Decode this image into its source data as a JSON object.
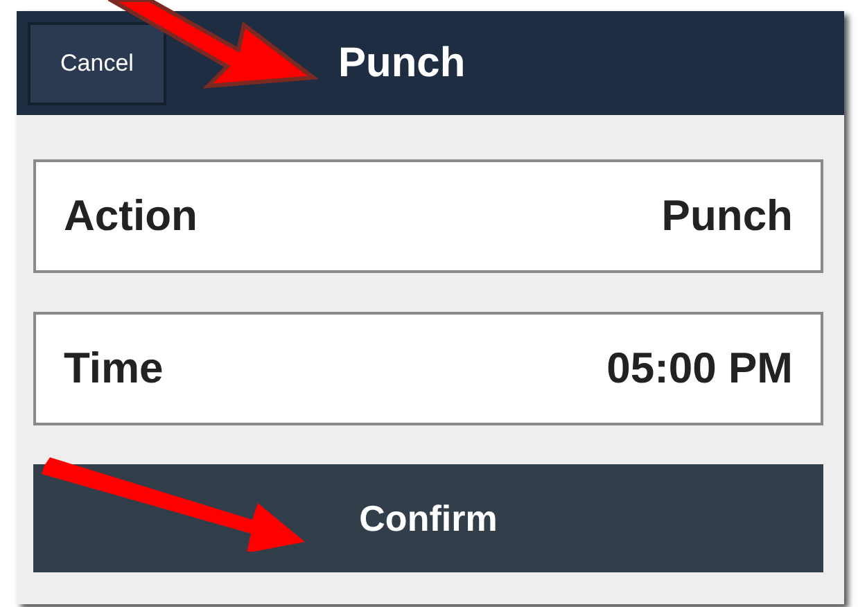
{
  "header": {
    "cancel_button": "Cancel",
    "title": "Punch"
  },
  "fields": [
    {
      "label": "Action",
      "value": "Punch"
    },
    {
      "label": "Time",
      "value": "05:00 PM"
    }
  ],
  "confirm_button": "Confirm"
}
